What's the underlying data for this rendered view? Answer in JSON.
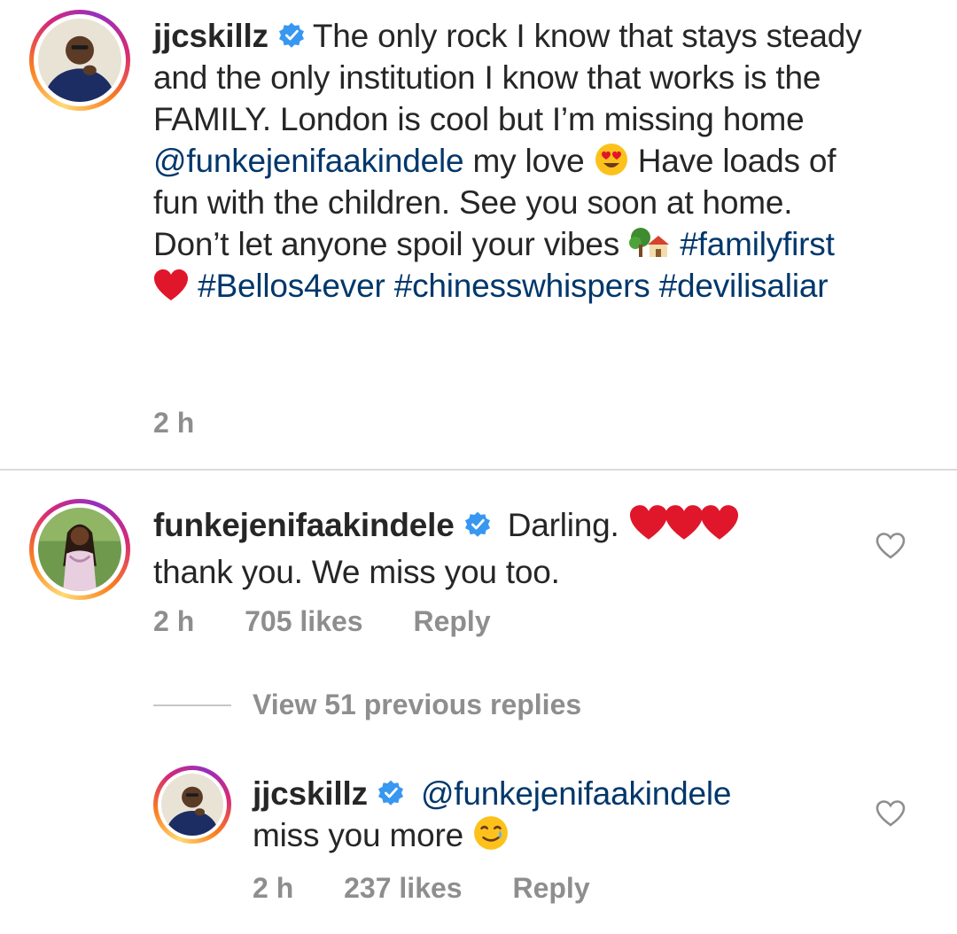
{
  "caption": {
    "username": "jjcskillz",
    "text_before_mention": "The only rock I know that stays steady and the only institution I know that works is the FAMILY. London is cool but I’m missing home",
    "mention": "@funkejenifaakindele",
    "text_after_mention": "my love",
    "text_after_emoji": "Have loads of fun with the children. See you soon at home. Don’t let anyone spoil your vibes",
    "hashtag_1": "#familyfirst",
    "hashtag_2": "#Bellos4ever",
    "hashtag_3": "#chinesswhispers",
    "hashtag_4": "#devilisaliar",
    "time": "2 h"
  },
  "comment_1": {
    "username": "funkejenifaakindele",
    "text_line1": "Darling.",
    "text_line2": "thank you. We miss you too.",
    "time": "2 h",
    "likes": "705 likes",
    "reply_label": "Reply"
  },
  "view_replies": "View 51 previous replies",
  "reply_1": {
    "username": "jjcskillz",
    "mention": "@funkejenifaakindele",
    "text": "miss you more",
    "time": "2 h",
    "likes": "237 likes",
    "reply_label": "Reply"
  },
  "icons": {
    "verified": "verified-badge-icon",
    "heart": "heart-outline-icon",
    "emoji_heart_eyes": "heart-eyes-emoji-icon",
    "emoji_house": "house-with-tree-emoji-icon",
    "emoji_red_heart": "red-heart-emoji-icon",
    "emoji_tear_smile": "smiling-face-with-tear-emoji-icon"
  },
  "colors": {
    "text": "#262626",
    "link": "#00376b",
    "meta": "#8e8e8e",
    "verified": "#3897f0",
    "heart_red": "#e0162b"
  }
}
